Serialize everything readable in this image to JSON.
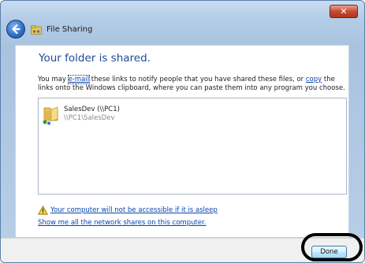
{
  "window": {
    "title": "File Sharing",
    "close_label": "✕"
  },
  "content": {
    "heading": "Your folder is shared.",
    "desc_prefix": "You may ",
    "desc_email_link": "e-mail",
    "desc_middle": " these links to notify people that you have shared these files, or ",
    "desc_copy_link": "copy",
    "desc_suffix": " the links onto the Windows clipboard, where you can paste them into any program you choose.",
    "shares": [
      {
        "name": "SalesDev (\\\\PC1)",
        "path": "\\\\PC1\\SalesDev",
        "icon": "shared-folder-icon"
      }
    ],
    "warning_link": "Your computer will not be accessible if it is asleep",
    "show_shares_link": "Show me all the network shares on this computer."
  },
  "footer": {
    "done_label": "Done"
  },
  "colors": {
    "heading": "#1e4b9a",
    "link": "#0645ad",
    "highlight": "#000000"
  }
}
